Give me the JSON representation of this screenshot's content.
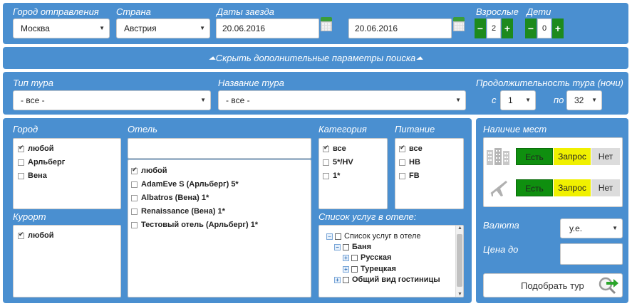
{
  "top": {
    "departure_city_label": "Город отправления",
    "departure_city_value": "Москва",
    "country_label": "Страна",
    "country_value": "Австрия",
    "dates_label": "Даты заезда",
    "date_from": "20.06.2016",
    "date_to": "20.06.2016",
    "adults_label": "Взрослые",
    "adults_value": "2",
    "children_label": "Дети",
    "children_value": "0",
    "minus": "−",
    "plus": "+"
  },
  "toggle": {
    "label": "Скрыть дополнительные параметры поиска"
  },
  "tour": {
    "type_label": "Тип тура",
    "type_value": "- все -",
    "name_label": "Название тура",
    "name_value": "- все -",
    "duration_label": "Продолжительность тура (ночи)",
    "from_label": "с",
    "from_value": "1",
    "to_label": "по",
    "to_value": "32"
  },
  "city": {
    "label": "Город",
    "items": [
      {
        "label": "любой",
        "checked": true
      },
      {
        "label": "Арльберг",
        "checked": false
      },
      {
        "label": "Вена",
        "checked": false
      }
    ]
  },
  "resort": {
    "label": "Курорт",
    "items": [
      {
        "label": "любой",
        "checked": true
      }
    ]
  },
  "hotel": {
    "label": "Отель",
    "search_value": "",
    "items": [
      {
        "label": "любой",
        "checked": true
      },
      {
        "label": "AdamEve S (Арльберг) 5*",
        "checked": false
      },
      {
        "label": "Albatros (Вена) 1*",
        "checked": false
      },
      {
        "label": "Renaissance (Вена) 1*",
        "checked": false
      },
      {
        "label": "Тестовый отель (Арльберг) 1*",
        "checked": false
      }
    ]
  },
  "category": {
    "label": "Категория",
    "items": [
      {
        "label": "все",
        "checked": true
      },
      {
        "label": "5*/HV",
        "checked": false
      },
      {
        "label": "1*",
        "checked": false
      }
    ]
  },
  "meals": {
    "label": "Питание",
    "items": [
      {
        "label": "все",
        "checked": true
      },
      {
        "label": "HB",
        "checked": false
      },
      {
        "label": "FB",
        "checked": false
      }
    ]
  },
  "services": {
    "label": "Список услуг в отеле:",
    "tree": [
      {
        "label": "Список услуг в отеле",
        "bold": false
      },
      {
        "label": "Баня",
        "bold": true
      },
      {
        "label": "Русская",
        "bold": true
      },
      {
        "label": "Турецкая",
        "bold": true
      },
      {
        "label": "Общий вид гостиницы",
        "bold": true
      }
    ]
  },
  "availability": {
    "label": "Наличие мест",
    "yes": "Есть",
    "request": "Запрос",
    "no": "Нет",
    "colors": {
      "yes": "#0f8f0f",
      "request": "#f0f000",
      "no": "#dcdcdc"
    }
  },
  "currency": {
    "label": "Валюта",
    "value": "у.е."
  },
  "price": {
    "label": "Цена до",
    "value": ""
  },
  "submit": {
    "label": "Подобрать тур"
  }
}
